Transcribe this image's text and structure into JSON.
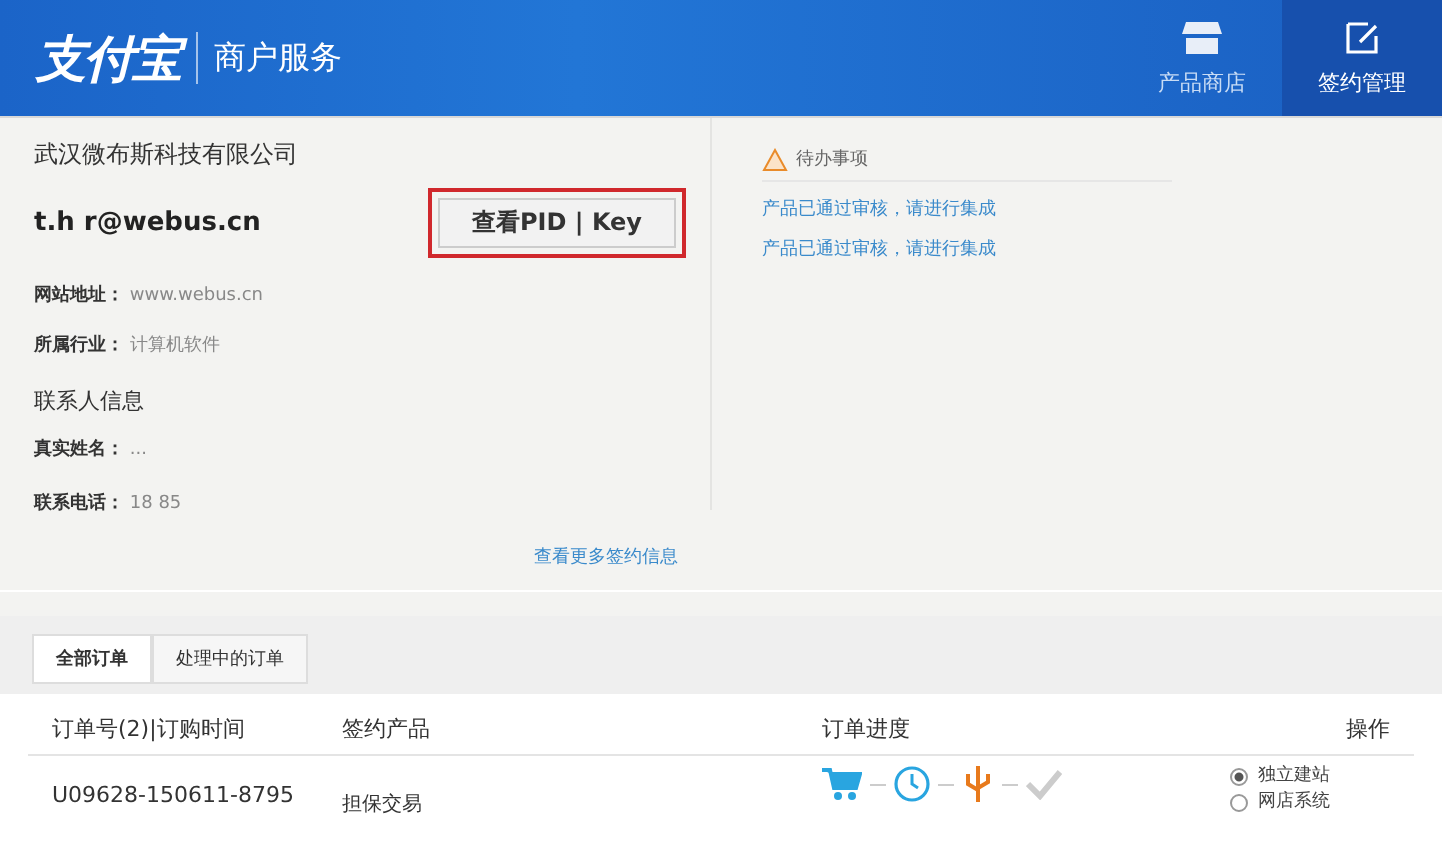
{
  "header": {
    "logo": "支付宝",
    "service": "商户服务",
    "nav": [
      {
        "label": "产品商店",
        "kind": "store",
        "selected": false
      },
      {
        "label": "签约管理",
        "kind": "edit",
        "selected": true
      }
    ]
  },
  "account": {
    "company": "武汉微布斯科技有限公司",
    "email": "t.h r@webus.cn",
    "pid_button": "查看PID | Key",
    "fields": [
      {
        "label": "网站地址：",
        "value": "www.webus.cn"
      },
      {
        "label": "所属行业：",
        "value": "计算机软件"
      }
    ],
    "contact_title": "联系人信息",
    "contact_fields": [
      {
        "label": "真实姓名：",
        "value": "..."
      },
      {
        "label": "联系电话：",
        "value": "18   85"
      }
    ],
    "more_link": "查看更多签约信息"
  },
  "todo": {
    "title": "待办事项",
    "items": [
      "产品已通过审核，请进行集成",
      "产品已通过审核，请进行集成"
    ]
  },
  "orders": {
    "tabs": [
      {
        "label": "全部订单",
        "selected": true
      },
      {
        "label": "处理中的订单",
        "selected": false
      }
    ],
    "columns": [
      "订单号(2)|订购时间",
      "签约产品",
      "订单进度",
      "操作"
    ],
    "rows": [
      {
        "order_no": "U09628-150611-8795",
        "product": "担保交易",
        "steps": [
          {
            "kind": "cart",
            "done": true
          },
          {
            "kind": "clock",
            "done": true
          },
          {
            "kind": "usb",
            "done": true
          },
          {
            "kind": "check",
            "done": false
          }
        ],
        "options": [
          {
            "label": "独立建站",
            "selected": true
          },
          {
            "label": "网店系统",
            "selected": false
          }
        ]
      }
    ]
  }
}
